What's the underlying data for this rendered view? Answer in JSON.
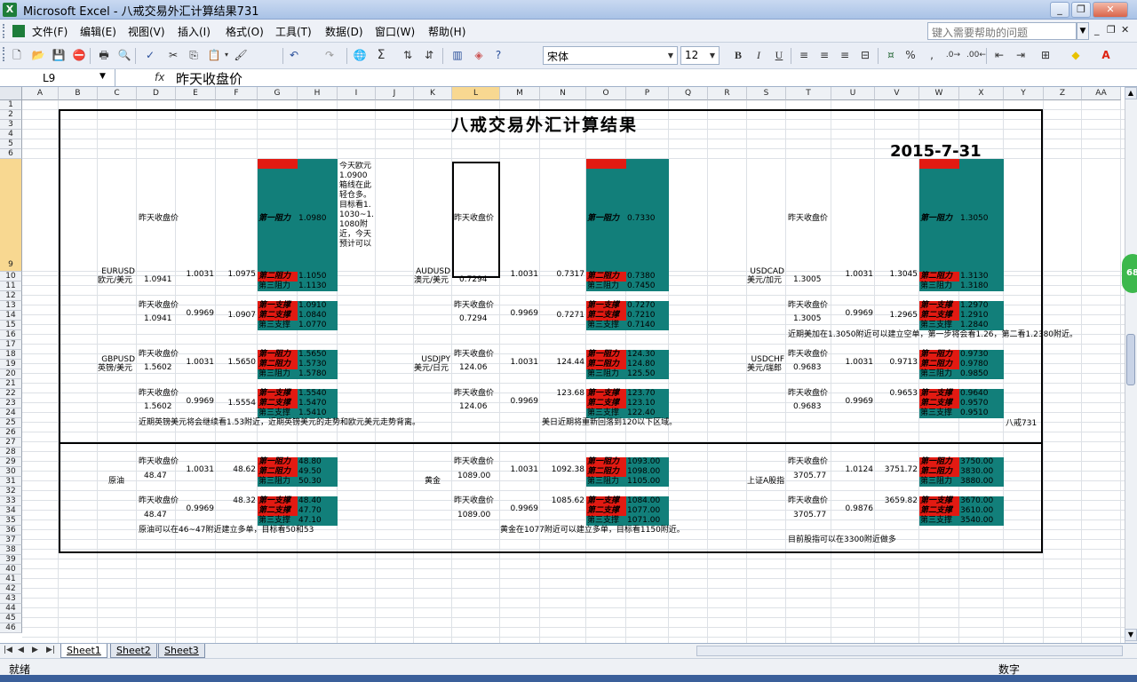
{
  "window": {
    "title": "Microsoft Excel - 八戒交易外汇计算结果731",
    "minimize": "_",
    "restore": "❐",
    "close": "✕"
  },
  "menu": [
    "文件(F)",
    "编辑(E)",
    "视图(V)",
    "插入(I)",
    "格式(O)",
    "工具(T)",
    "数据(D)",
    "窗口(W)",
    "帮助(H)"
  ],
  "help_placeholder": "键入需要帮助的问题",
  "toolbar": {
    "font": "宋体",
    "size": "12",
    "bold": "B",
    "italic": "I",
    "underline": "U",
    "sum": "Σ",
    "percent": "%",
    "comma": ","
  },
  "name_box": "L9",
  "fx": "fx",
  "formula": "昨天收盘价",
  "columns": [
    "A",
    "B",
    "C",
    "D",
    "E",
    "F",
    "G",
    "H",
    "I",
    "J",
    "K",
    "L",
    "M",
    "N",
    "O",
    "P",
    "Q",
    "R",
    "S",
    "T",
    "U",
    "V",
    "W",
    "X",
    "Y",
    "Z",
    "AA"
  ],
  "rows": [
    "1",
    "2",
    "3",
    "4",
    "5",
    "6",
    "9",
    "10",
    "11",
    "12",
    "13",
    "14",
    "15",
    "16",
    "17",
    "18",
    "19",
    "20",
    "21",
    "22",
    "23",
    "24",
    "25",
    "26",
    "27",
    "28",
    "29",
    "30",
    "31",
    "32",
    "33",
    "34",
    "35",
    "36",
    "37",
    "38",
    "39",
    "40",
    "41",
    "42",
    "43",
    "44",
    "45",
    "46"
  ],
  "sheet": {
    "title": "八戒交易外汇计算结果",
    "date": "2015-7-31",
    "labels": {
      "yesterday_close": "昨天收盘价",
      "r1": "第一阻力",
      "r2": "第二阻力",
      "r3": "第三阻力",
      "s1": "第一支撑",
      "s2": "第二支撑",
      "s3": "第三支撑"
    },
    "i9_note": "今天欧元1.0900箱线在此轻仓多。目标看1.1030~1.1080附近，今天预计可以",
    "eurusd": {
      "name": "EURUSD",
      "cn": "欧元/美元",
      "r1": "1.0980",
      "r2": "1.1050",
      "r3": "1.1130",
      "close": "1.0941",
      "k1": "1.0031",
      "v1": "1.0975",
      "s1": "1.0910",
      "s2": "1.0840",
      "s3": "1.0770",
      "close2": "1.0941",
      "k2": "0.9969",
      "v2": "1.0907"
    },
    "audusd": {
      "name": "AUDUSD",
      "cn": "澳元/美元",
      "r1": "0.7330",
      "r2": "0.7380",
      "r3": "0.7450",
      "close": "0.7294",
      "k1": "1.0031",
      "v1": "0.7317",
      "s1": "0.7270",
      "s2": "0.7210",
      "s3": "0.7140",
      "close2": "0.7294",
      "k2": "0.9969",
      "v2": "0.7271"
    },
    "usdcad": {
      "name": "USDCAD",
      "cn": "美元/加元",
      "r1": "1.3050",
      "r2": "1.3130",
      "r3": "1.3180",
      "close": "1.3005",
      "k1": "1.0031",
      "v1": "1.3045",
      "s1": "1.2970",
      "s2": "1.2910",
      "s3": "1.2840",
      "close2": "1.3005",
      "k2": "0.9969",
      "v2": "1.2965"
    },
    "note_cad": "近期美加在1.3050附近可以建立空单，第一步将会看1.26，第二看1.2380附近。",
    "gbpusd": {
      "name": "GBPUSD",
      "cn": "英镑/美元",
      "r1": "1.5650",
      "r2": "1.5730",
      "r3": "1.5780",
      "close": "1.5602",
      "k1": "1.0031",
      "v1": "1.5650",
      "s1": "1.5540",
      "s2": "1.5470",
      "s3": "1.5410",
      "close2": "1.5602",
      "k2": "0.9969",
      "v2": "1.5554"
    },
    "usdjpy": {
      "name": "USDJPY",
      "cn": "美元/日元",
      "r1": "124.30",
      "r2": "124.80",
      "r3": "125.50",
      "close": "124.06",
      "k1": "1.0031",
      "v1": "124.44",
      "s1": "123.70",
      "s2": "123.10",
      "s3": "122.40",
      "close2": "124.06",
      "k2": "0.9969",
      "v2": "123.68"
    },
    "usdchf": {
      "name": "USDCHF",
      "cn": "美元/瑞郎",
      "r1": "0.9730",
      "r2": "0.9780",
      "r3": "0.9850",
      "close": "0.9683",
      "k1": "1.0031",
      "v1": "0.9713",
      "s1": "0.9640",
      "s2": "0.9570",
      "s3": "0.9510",
      "close2": "0.9683",
      "k2": "0.9969",
      "v2": "0.9653"
    },
    "note_gbp": "近期英镑美元将会继续看1.53附近，近期英镑美元的走势和欧元美元走势背离。",
    "note_jpy": "美日近期将重新回落到120以下区域。",
    "sign": "八戒731",
    "oil": {
      "name": "原油",
      "r1": "48.80",
      "r2": "49.50",
      "r3": "50.30",
      "close": "48.47",
      "k1": "1.0031",
      "v1": "48.62",
      "s1": "48.40",
      "s2": "47.70",
      "s3": "47.10",
      "close2": "48.47",
      "k2": "0.9969",
      "v2": "48.32"
    },
    "gold": {
      "name": "黄金",
      "r1": "1093.00",
      "r2": "1098.00",
      "r3": "1105.00",
      "close": "1089.00",
      "k1": "1.0031",
      "v1": "1092.38",
      "s1": "1084.00",
      "s2": "1077.00",
      "s3": "1071.00",
      "close2": "1089.00",
      "k2": "0.9969",
      "v2": "1085.62"
    },
    "index": {
      "name": "上证A股指",
      "r1": "3750.00",
      "r2": "3830.00",
      "r3": "3880.00",
      "close": "3705.77",
      "k1": "1.0124",
      "v1": "3751.72",
      "s1": "3670.00",
      "s2": "3610.00",
      "s3": "3540.00",
      "close2": "3705.77",
      "k2": "0.9876",
      "v2": "3659.82"
    },
    "note_oil": "原油可以在46~47附近建立多单，目标看50和53",
    "note_gold": "黄金在1077附近可以建立多单，目标看1150附近。",
    "note_index": "目前股指可以在3300附近做多"
  },
  "tabs": [
    "Sheet1",
    "Sheet2",
    "Sheet3"
  ],
  "status": {
    "ready": "就绪",
    "num": "数字"
  },
  "badge": "68",
  "colors": {
    "teal": "#127f7a",
    "red": "#e21a12",
    "selected_header": "#f8d891"
  }
}
